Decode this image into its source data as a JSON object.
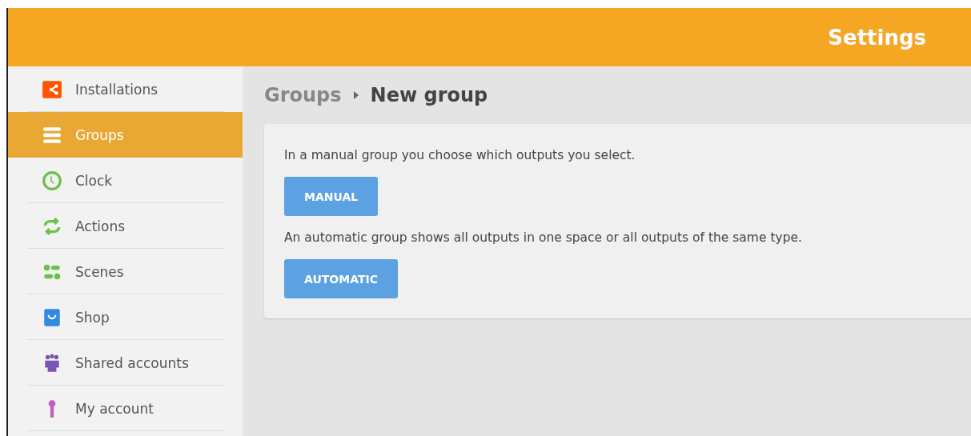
{
  "header": {
    "title": "Settings"
  },
  "sidebar": {
    "items": [
      {
        "label": "Installations",
        "kind": "installations",
        "selected": false
      },
      {
        "label": "Groups",
        "kind": "groups",
        "selected": true
      },
      {
        "label": "Clock",
        "kind": "clock",
        "selected": false
      },
      {
        "label": "Actions",
        "kind": "actions",
        "selected": false
      },
      {
        "label": "Scenes",
        "kind": "scenes",
        "selected": false
      },
      {
        "label": "Shop",
        "kind": "shop",
        "selected": false
      },
      {
        "label": "Shared accounts",
        "kind": "shared",
        "selected": false
      },
      {
        "label": "My account",
        "kind": "account",
        "selected": false
      }
    ]
  },
  "breadcrumb": {
    "parent": "Groups",
    "current": "New group"
  },
  "card": {
    "sections": [
      {
        "text": "In a manual group you choose which outputs you select.",
        "button": "MANUAL"
      },
      {
        "text": "An automatic group shows all outputs in one space or all outputs of the same type.",
        "button": "AUTOMATIC"
      }
    ]
  }
}
